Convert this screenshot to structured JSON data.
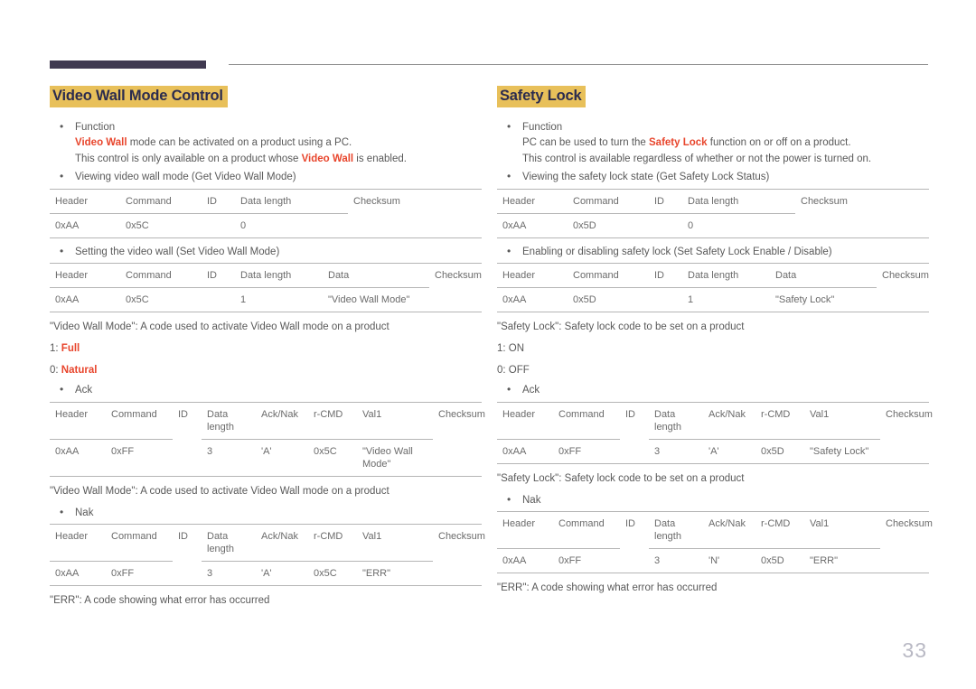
{
  "page": {
    "number": "33",
    "accent_highlight": "#e8c05a",
    "accent_heading_text": "#2b2b4e",
    "accent_emphasis": "#e8452c",
    "rule_dark": "#403a51",
    "rule_light": "#b5b5b5"
  },
  "left": {
    "title": "Video Wall Mode Control",
    "function_bullet": {
      "label": "Function",
      "line1_pre": "",
      "line1_hl": "Video Wall",
      "line1_post": " mode can be activated on a product using a PC.",
      "line2_pre": "This control is only available on a product whose ",
      "line2_hl": "Video Wall",
      "line2_post": " is enabled."
    },
    "get_bullet": "Viewing video wall mode (Get Video Wall Mode)",
    "get_table": {
      "headers": [
        "Header",
        "Command",
        "ID",
        "Data length",
        "Checksum"
      ],
      "row": [
        "0xAA",
        "0x5C",
        "",
        "0",
        ""
      ]
    },
    "set_bullet": "Setting the video wall (Set Video Wall Mode)",
    "set_table": {
      "headers": [
        "Header",
        "Command",
        "ID",
        "Data length",
        "Data",
        "Checksum"
      ],
      "row": [
        "0xAA",
        "0x5C",
        "",
        "1",
        "\"Video Wall Mode\"",
        ""
      ]
    },
    "note_set": "\"Video Wall Mode\": A code used to activate Video Wall mode on a product",
    "values": [
      {
        "key": "1: ",
        "val": "Full"
      },
      {
        "key": "0: ",
        "val": "Natural"
      }
    ],
    "ack_bullet": "Ack",
    "ack_table": {
      "headers": [
        "Header",
        "Command",
        "ID",
        "Data length",
        "Ack/Nak",
        "r-CMD",
        "Val1",
        "Checksum"
      ],
      "row": [
        "0xAA",
        "0xFF",
        "",
        "3",
        "'A'",
        "0x5C",
        "\"Video Wall Mode\"",
        ""
      ]
    },
    "note_ack": "\"Video Wall Mode\": A code used to activate Video Wall mode on a product",
    "nak_bullet": "Nak",
    "nak_table": {
      "headers": [
        "Header",
        "Command",
        "ID",
        "Data length",
        "Ack/Nak",
        "r-CMD",
        "Val1",
        "Checksum"
      ],
      "row": [
        "0xAA",
        "0xFF",
        "",
        "3",
        "'A'",
        "0x5C",
        "\"ERR\"",
        ""
      ]
    },
    "note_nak": "\"ERR\": A code showing what error has occurred"
  },
  "right": {
    "title": "Safety Lock",
    "function_bullet": {
      "label": "Function",
      "line1_pre": "PC can be used to turn the ",
      "line1_hl": "Safety Lock",
      "line1_post": " function on or off on a product.",
      "line2_pre": "This control is available regardless of whether or not the power is turned on.",
      "line2_hl": "",
      "line2_post": ""
    },
    "get_bullet": "Viewing the safety lock state (Get Safety Lock Status)",
    "get_table": {
      "headers": [
        "Header",
        "Command",
        "ID",
        "Data length",
        "Checksum"
      ],
      "row": [
        "0xAA",
        "0x5D",
        "",
        "0",
        ""
      ]
    },
    "set_bullet": "Enabling or disabling safety lock (Set Safety Lock Enable / Disable)",
    "set_table": {
      "headers": [
        "Header",
        "Command",
        "ID",
        "Data length",
        "Data",
        "Checksum"
      ],
      "row": [
        "0xAA",
        "0x5D",
        "",
        "1",
        "\"Safety Lock\"",
        ""
      ]
    },
    "note_set": "\"Safety Lock\": Safety lock code to be set on a product",
    "values": [
      {
        "key": "1: ",
        "val": "ON"
      },
      {
        "key": "0: ",
        "val": "OFF"
      }
    ],
    "ack_bullet": "Ack",
    "ack_table": {
      "headers": [
        "Header",
        "Command",
        "ID",
        "Data length",
        "Ack/Nak",
        "r-CMD",
        "Val1",
        "Checksum"
      ],
      "row": [
        "0xAA",
        "0xFF",
        "",
        "3",
        "'A'",
        "0x5D",
        "\"Safety Lock\"",
        ""
      ]
    },
    "note_ack": "\"Safety Lock\": Safety lock code to be set on a product",
    "nak_bullet": "Nak",
    "nak_table": {
      "headers": [
        "Header",
        "Command",
        "ID",
        "Data length",
        "Ack/Nak",
        "r-CMD",
        "Val1",
        "Checksum"
      ],
      "row": [
        "0xAA",
        "0xFF",
        "",
        "3",
        "'N'",
        "0x5D",
        "\"ERR\"",
        ""
      ]
    },
    "note_nak": "\"ERR\": A code showing what error has occurred"
  }
}
